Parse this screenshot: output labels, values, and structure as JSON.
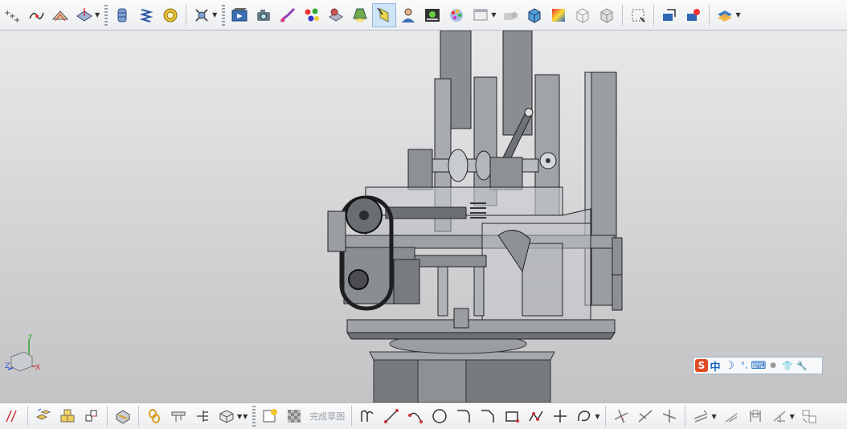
{
  "top_toolbar": {
    "groups": [
      [
        "point-set-icon",
        "curve-on-surface-icon",
        "offset-curve-icon",
        "project-curve-icon"
      ],
      [
        "extrude-cylinder-icon",
        "spring-icon",
        "coil-icon"
      ],
      [
        "assembly-tool-icon"
      ],
      [
        "animation-icon",
        "camera-icon",
        "brush-icon",
        "color-balls-icon",
        "material-icon",
        "light-icon",
        "selected-highlight-icon",
        "user-icon",
        "image-icon",
        "palette-icon",
        "window-icon",
        "render-icon",
        "box-tint-icon",
        "gradient-icon",
        "wireframe-icon",
        "shaded-box-icon"
      ],
      [
        "fit-view-icon",
        "display-part-icon",
        "edit-part-icon"
      ],
      [
        "layer-settings-icon"
      ]
    ]
  },
  "bottom_toolbar": {
    "finish_sketch_label": "完成草图",
    "groups_left": [
      "constraint-icon",
      "assembly-icon",
      "component-icon",
      "pattern-icon",
      "inspect-icon",
      "link-icon",
      "measure-icon",
      "layout-icon",
      "view-3d-icon"
    ],
    "sketch_tools": [
      "profile-icon",
      "line-icon",
      "arc-icon",
      "circle-icon",
      "fillet-icon",
      "chamfer-icon",
      "rectangle-icon",
      "polyline-icon",
      "point-icon",
      "studio-spline-icon"
    ],
    "edit_tools": [
      "quick-trim-icon",
      "quick-extend-icon",
      "make-corner-icon",
      "offset-icon",
      "mirror-icon",
      "dimension-icon",
      "constraint-display-icon",
      "sketch-settings-icon"
    ]
  },
  "triad": {
    "x_label": "X",
    "y_label": "Y",
    "z_label": "Z"
  },
  "ime_bar": {
    "logo": "S",
    "mode": "中",
    "moon": "☽",
    "punct": "°,",
    "keyboard": "⌨",
    "user": "●",
    "shirt": "👕",
    "wrench": "🔧"
  },
  "colors": {
    "accent": "#1565c0",
    "ime_logo": "#e24a22",
    "model_dark": "#5f6064",
    "model_mid": "#8a8b8f"
  }
}
